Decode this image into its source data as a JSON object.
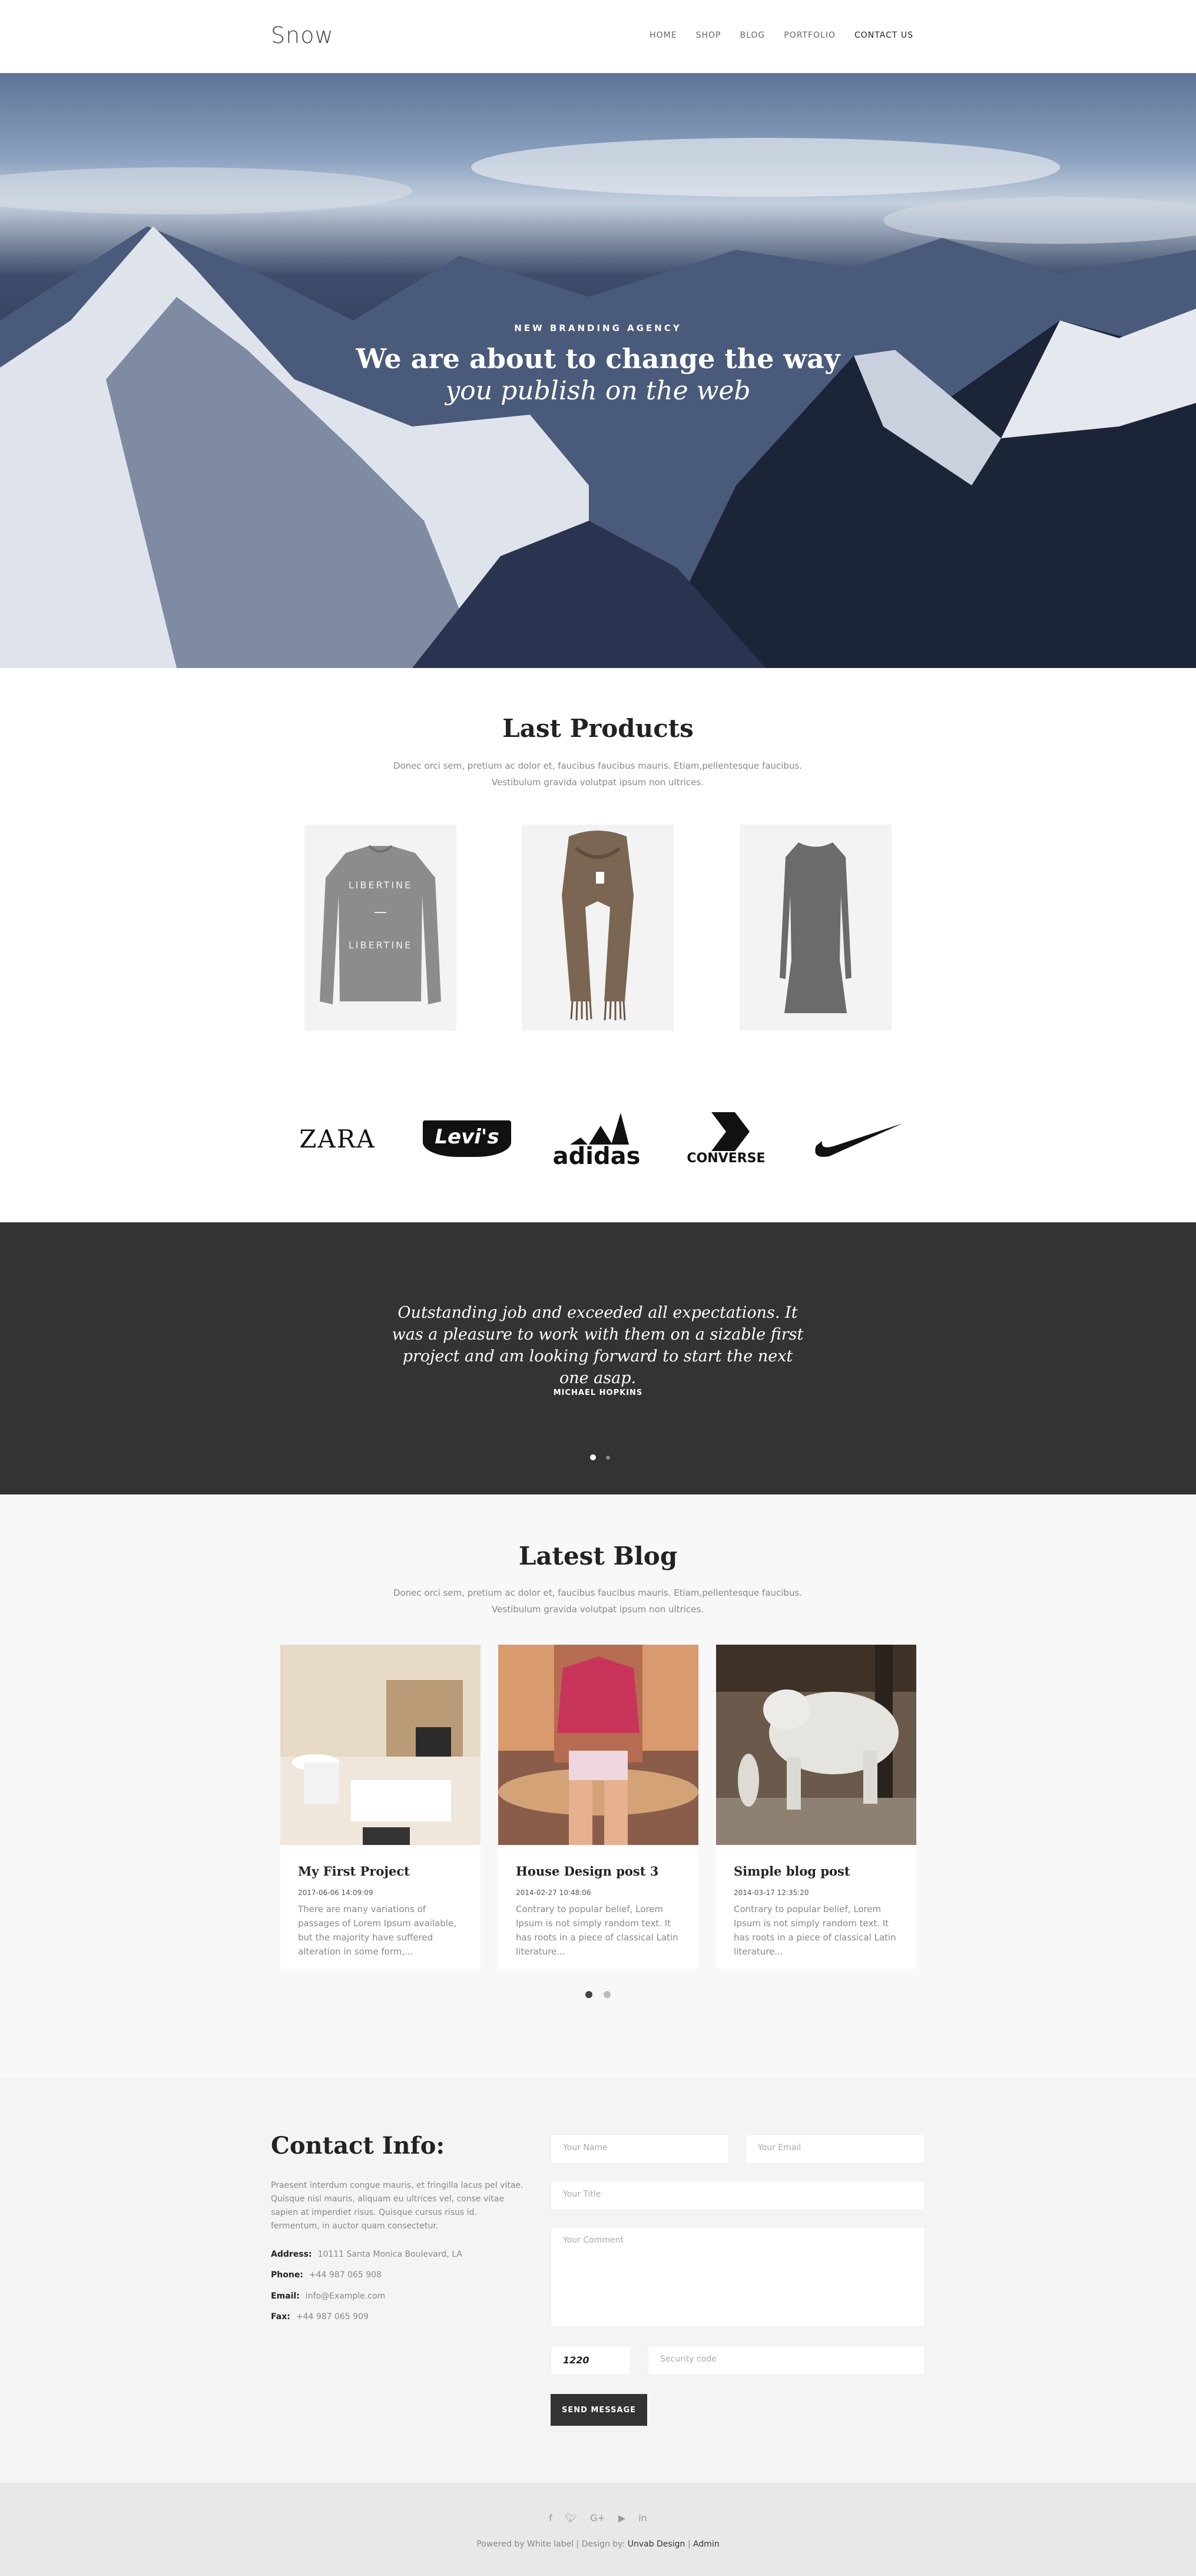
{
  "header": {
    "logo": "Snow",
    "nav": [
      "HOME",
      "SHOP",
      "BLOG",
      "PORTFOLIO",
      "CONTACT US"
    ]
  },
  "hero": {
    "kicker": "NEW BRANDING AGENCY",
    "title": "We are about to change the way",
    "subtitle": "you publish on the web"
  },
  "products": {
    "title": "Last Products",
    "description": "Donec orci sem, pretium ac dolor et, faucibus faucibus mauris. Etiam,pellentesque faucibus. Vestibulum gravida volutpat ipsum non ultrices.",
    "items": [
      {
        "kind": "sweatshirt",
        "print": "LIBERTINE"
      },
      {
        "kind": "scarf"
      },
      {
        "kind": "dress"
      }
    ]
  },
  "brands": [
    "ZARA",
    "Levi's",
    "adidas",
    "CONVERSE",
    "nike-swoosh"
  ],
  "testimonial": {
    "quote": "Outstanding job and exceeded all expectations. It was a pleasure to work with them on a sizable first project and am looking forward to start the next one asap.",
    "author": "MICHAEL HOPKINS"
  },
  "blog": {
    "title": "Latest Blog",
    "description": "Donec orci sem, pretium ac dolor et, faucibus faucibus mauris. Etiam,pellentesque faucibus. Vestibulum gravida volutpat ipsum non ultrices.",
    "posts": [
      {
        "title": "My First Project",
        "date": "2017-06-06 14:09:09",
        "excerpt": "There are many variations of passages of Lorem Ipsum available, but the majority have suffered alteration in some form,..."
      },
      {
        "title": "House Design post 3",
        "date": "2014-02-27 10:48:06",
        "excerpt": "Contrary to popular belief, Lorem Ipsum is not simply random text. It has roots in a piece of classical Latin literature..."
      },
      {
        "title": "Simple blog post",
        "date": "2014-03-17 12:35:20",
        "excerpt": "Contrary to popular belief, Lorem Ipsum is not simply random text. It has roots in a piece of classical Latin literature..."
      }
    ]
  },
  "contact": {
    "title": "Contact Info:",
    "text": "Praesent interdum congue mauris, et fringilla lacus pel vitae. Quisque nisl mauris, aliquam eu ultrices vel, conse vitae sapien at imperdiet risus. Quisque cursus risus id. fermentum, in auctor quam consectetur.",
    "address_label": "Address:",
    "address": "10111 Santa Monica Boulevard, LA",
    "phone_label": "Phone:",
    "phone": "+44 987 065 908",
    "email_label": "Email:",
    "email": "info@Example.com",
    "fax_label": "Fax:",
    "fax": "+44 987 065 909",
    "form": {
      "name_placeholder": "Your Name",
      "email_placeholder": "Your Email",
      "title_placeholder": "Your Title",
      "comment_placeholder": "Your Comment",
      "captcha": "1220",
      "security_placeholder": "Security code",
      "submit": "SEND MESSAGE"
    }
  },
  "footer": {
    "social": [
      "f",
      "t",
      "G+",
      "yt",
      "in"
    ],
    "powered": "Powered by White label | Design by:",
    "designer": "Unvab Design",
    "separator": " | ",
    "admin": "Admin"
  },
  "colors": {
    "dark": "#333333",
    "page_bg": "#f8f8f8",
    "contact_bg": "#f4f4f4",
    "footer_bg": "#e8e8e8"
  }
}
